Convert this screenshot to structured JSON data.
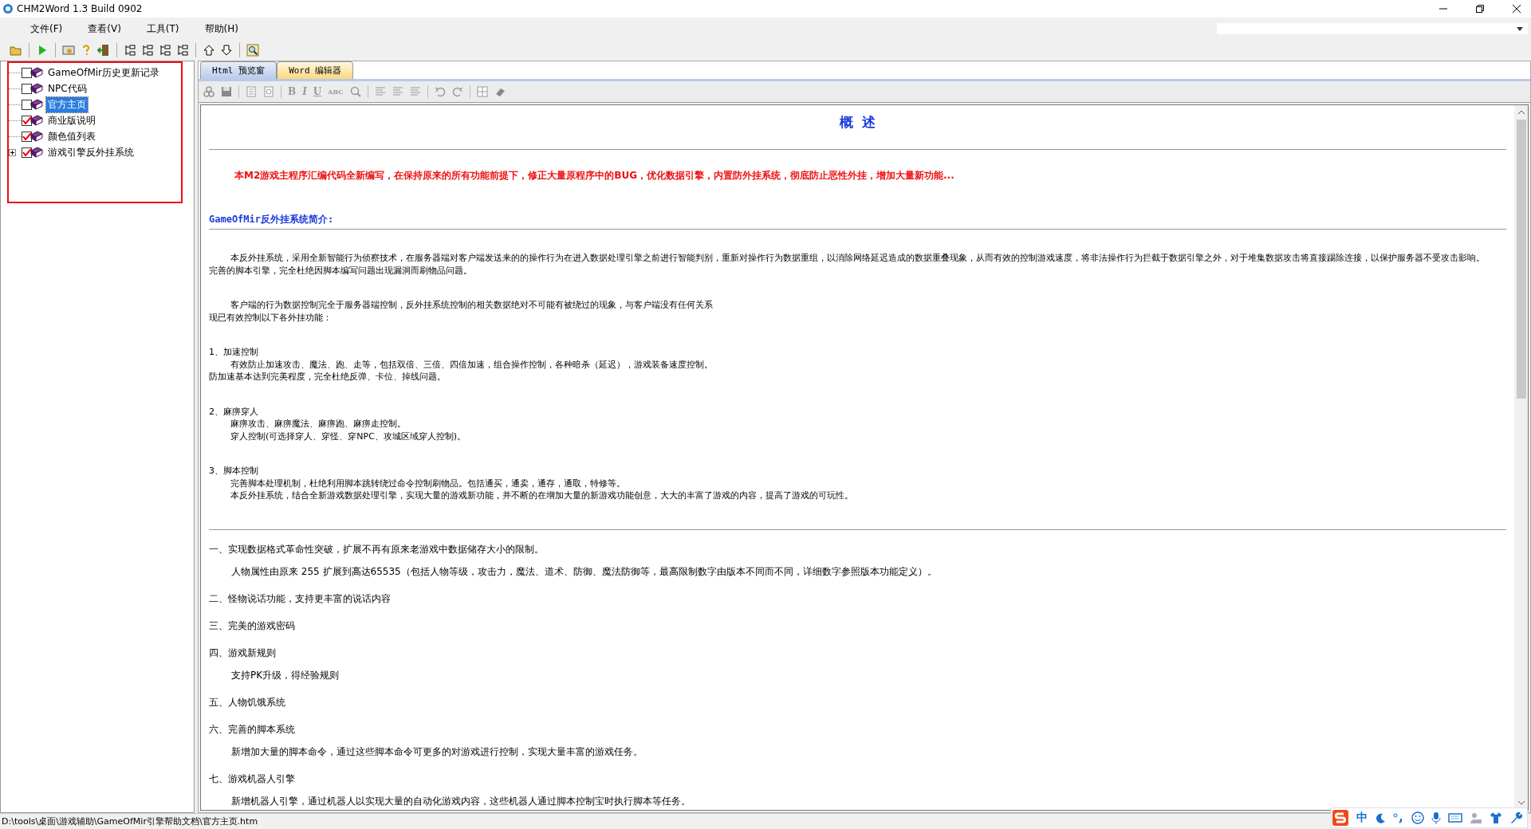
{
  "window": {
    "title": "CHM2Word 1.3 Build 0902"
  },
  "menu": [
    "文件(F)",
    "查看(V)",
    "工具(T)",
    "帮助(H)"
  ],
  "tree": [
    {
      "label": "GameOfMir历史更新记录",
      "checked": false,
      "selected": false
    },
    {
      "label": "NPC代码",
      "checked": false,
      "selected": false
    },
    {
      "label": "官方主页",
      "checked": false,
      "selected": true
    },
    {
      "label": "商业版说明",
      "checked": true,
      "selected": false
    },
    {
      "label": "颜色值列表",
      "checked": true,
      "selected": false
    },
    {
      "label": "游戏引擎反外挂系统",
      "checked": true,
      "selected": false,
      "expanded": false
    }
  ],
  "tabs": [
    {
      "label": "Html 预览窗",
      "selected": false
    },
    {
      "label": "Word 编辑器",
      "selected": true
    }
  ],
  "format_buttons": [
    "B",
    "I",
    "U",
    "ABC"
  ],
  "document": {
    "heading": "概  述",
    "notice": "本M2游戏主程序汇编代码全新编写，在保持原来的所有功能前提下，修正大量原程序中的BUG，优化数据引擎，内置防外挂系统，彻底防止恶性外挂，增加大量新功能...",
    "section_title": "GameOfMir反外挂系统简介:",
    "blocks": [
      {
        "lines": [
          {
            "text": "本反外挂系统，采用全新智能行为侦察技术，在服务器端对客户端发送来的的操作行为在进入数据处理引擎之前进行智能判别，重新对操作行为数据重组，以消除网络延迟造成的数据重叠现象，从而有效的控制游戏速度，将非法操作行为拦截于数据引擎之外，对于堆集数据攻击将直接踢除连接，以保护服务器不受攻击影响。",
            "indent": true
          },
          {
            "text": "完善的脚本引擎，完全杜绝因脚本编写问题出现漏洞而刷物品问题。",
            "indent": false
          }
        ]
      },
      {
        "lines": [
          {
            "text": "客户端的行为数据控制完全于服务器端控制，反外挂系统控制的相关数据绝对不可能有被绕过的现象，与客户端没有任何关系",
            "indent": true
          },
          {
            "text": "现已有效控制以下各外挂功能：",
            "indent": false
          }
        ]
      },
      {
        "lines": [
          {
            "text": "1、加速控制",
            "indent": false
          },
          {
            "text": "有效防止加速攻击、魔法、跑、走等，包括双倍、三倍、四倍加速，组合操作控制，各种暗杀（延迟），游戏装备速度控制。",
            "indent": true
          },
          {
            "text": "防加速基本达到完美程度，完全杜绝反弹、卡位、掉线问题。",
            "indent": false
          }
        ]
      },
      {
        "lines": [
          {
            "text": "2、麻痹穿人",
            "indent": false
          },
          {
            "text": "麻痹攻击、麻痹魔法、麻痹跑、麻痹走控制。",
            "indent": true
          },
          {
            "text": "穿人控制(可选择穿人、穿怪、穿NPC、攻城区域穿人控制)。",
            "indent": true
          }
        ]
      },
      {
        "lines": [
          {
            "text": "3、脚本控制",
            "indent": false
          },
          {
            "text": "完善脚本处理机制，杜绝利用脚本跳转绕过命令控制刷物品。包括通买，通卖，通存，通取，特修等。",
            "indent": true
          },
          {
            "text": "本反外挂系统，结合全新游戏数据处理引擎，实现大量的游戏新功能，并不断的在增加大量的新游戏功能创意，大大的丰富了游戏的内容，提高了游戏的可玩性。",
            "indent": true
          }
        ]
      }
    ],
    "features": [
      {
        "title": "一、实现数据格式革命性突破，扩展不再有原来老游戏中数据储存大小的限制。",
        "details": [
          "人物属性由原来 255 扩展到高达65535（包括人物等级，攻击力，魔法、道术、防御、魔法防御等，最高限制数字由版本不同而不同，详细数字参照版本功能定义）。"
        ]
      },
      {
        "title": "二、怪物说话功能，支持更丰富的说话内容"
      },
      {
        "title": "三、完美的游戏密码"
      },
      {
        "title": "四、游戏新规则",
        "details": [
          "支持PK升级，得经验规则"
        ]
      },
      {
        "title": "五、人物饥饿系统"
      },
      {
        "title": "六、完善的脚本系统",
        "details": [
          "新增加大量的脚本命令，通过这些脚本命令可更多的对游戏进行控制，实现大量丰富的游戏任务。"
        ]
      },
      {
        "title": "七、游戏机器人引擎",
        "details": [
          "新增机器人引擎，通过机器人以实现大量的自动化游戏内容，这些机器人通过脚本控制宝时执行脚本等任务。"
        ]
      }
    ]
  },
  "status_bar": {
    "path": "D:\\tools\\桌面\\游戏辅助\\GameOfMir引擎帮助文档\\官方主页.htm"
  },
  "ime_bar": {
    "mode": "中"
  }
}
